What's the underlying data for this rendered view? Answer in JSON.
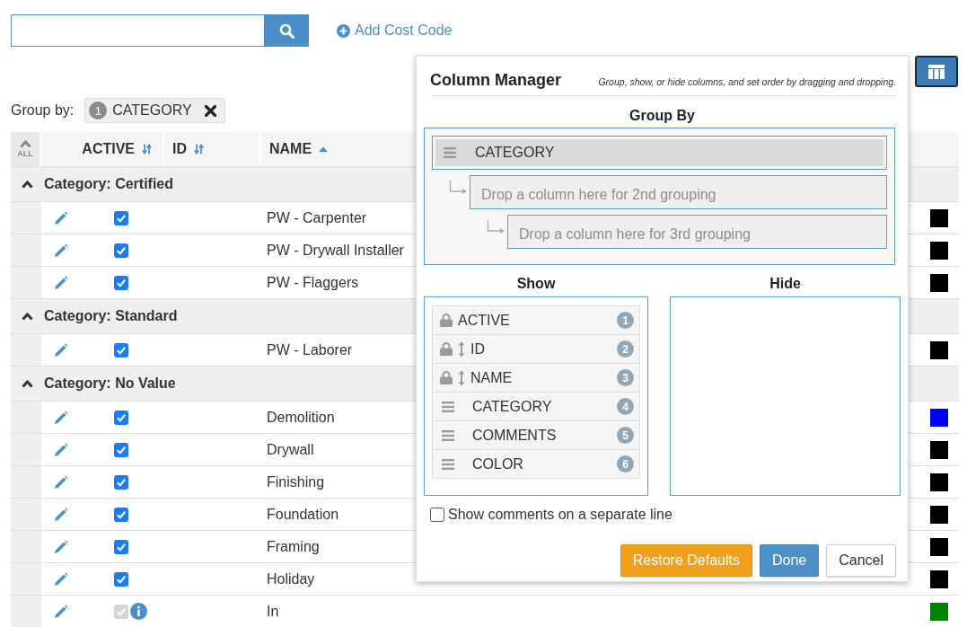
{
  "add_link": {
    "label": "Add Cost Code"
  },
  "column_manager_button": {
    "pressed": true
  },
  "group_by": {
    "label": "Group by:",
    "chips": [
      {
        "order": "1",
        "label": "CATEGORY"
      }
    ]
  },
  "table": {
    "collapse_all": "ALL",
    "columns": [
      {
        "label": "ACTIVE",
        "sorted": false
      },
      {
        "label": "ID",
        "sorted": false
      },
      {
        "label": "NAME",
        "sorted": true
      }
    ],
    "groups": [
      {
        "title": "Category: Certified",
        "expanded": true,
        "rows": [
          {
            "name": "PW - Carpenter",
            "active": true,
            "disabled": false,
            "info": false,
            "color": "#000000"
          },
          {
            "name": "PW - Drywall Installer",
            "active": true,
            "disabled": false,
            "info": false,
            "color": "#000000"
          },
          {
            "name": "PW - Flaggers",
            "active": true,
            "disabled": false,
            "info": false,
            "color": "#000000"
          }
        ]
      },
      {
        "title": "Category: Standard",
        "expanded": true,
        "rows": [
          {
            "name": "PW - Laborer",
            "active": true,
            "disabled": false,
            "info": false,
            "color": "#000000"
          }
        ]
      },
      {
        "title": "Category: No Value",
        "expanded": true,
        "rows": [
          {
            "name": "Demolition",
            "active": true,
            "disabled": false,
            "info": false,
            "color": "#0000ff"
          },
          {
            "name": "Drywall",
            "active": true,
            "disabled": false,
            "info": false,
            "color": "#000000"
          },
          {
            "name": "Finishing",
            "active": true,
            "disabled": false,
            "info": false,
            "color": "#000000"
          },
          {
            "name": "Foundation",
            "active": true,
            "disabled": false,
            "info": false,
            "color": "#000000"
          },
          {
            "name": "Framing",
            "active": true,
            "disabled": false,
            "info": false,
            "color": "#000000"
          },
          {
            "name": "Holiday",
            "active": true,
            "disabled": false,
            "info": false,
            "color": "#000000"
          },
          {
            "name": "In",
            "active": true,
            "disabled": true,
            "info": true,
            "color": "#008000"
          }
        ]
      }
    ]
  },
  "column_manager": {
    "title": "Column Manager",
    "hint": "Group, show, or hide columns, and set order by dragging and dropping.",
    "group_by": {
      "title": "Group By",
      "levels": [
        {
          "kind": "column",
          "label": "CATEGORY",
          "children": [
            {
              "kind": "drop",
              "label": "Drop a column here for 2nd grouping",
              "children": [
                {
                  "kind": "drop",
                  "label": "Drop a column here for 3rd grouping"
                }
              ]
            }
          ]
        }
      ]
    },
    "show": {
      "title": "Show",
      "items": [
        {
          "kind": "locked",
          "label": "ACTIVE",
          "order": "1"
        },
        {
          "kind": "locked_sortable",
          "label": "ID",
          "order": "2"
        },
        {
          "kind": "locked_sortable",
          "label": "NAME",
          "order": "3"
        },
        {
          "kind": "draggable",
          "label": "CATEGORY",
          "order": "4"
        },
        {
          "kind": "draggable",
          "label": "COMMENTS",
          "order": "5"
        },
        {
          "kind": "draggable",
          "label": "COLOR",
          "order": "6"
        }
      ]
    },
    "hide": {
      "title": "Hide"
    },
    "separate_comments": {
      "label": "Show comments on a separate line",
      "checked": false
    },
    "buttons": [
      {
        "kind": "warning",
        "label": "Restore Defaults"
      },
      {
        "kind": "primary",
        "label": "Done"
      },
      {
        "kind": "default",
        "label": "Cancel"
      }
    ]
  }
}
